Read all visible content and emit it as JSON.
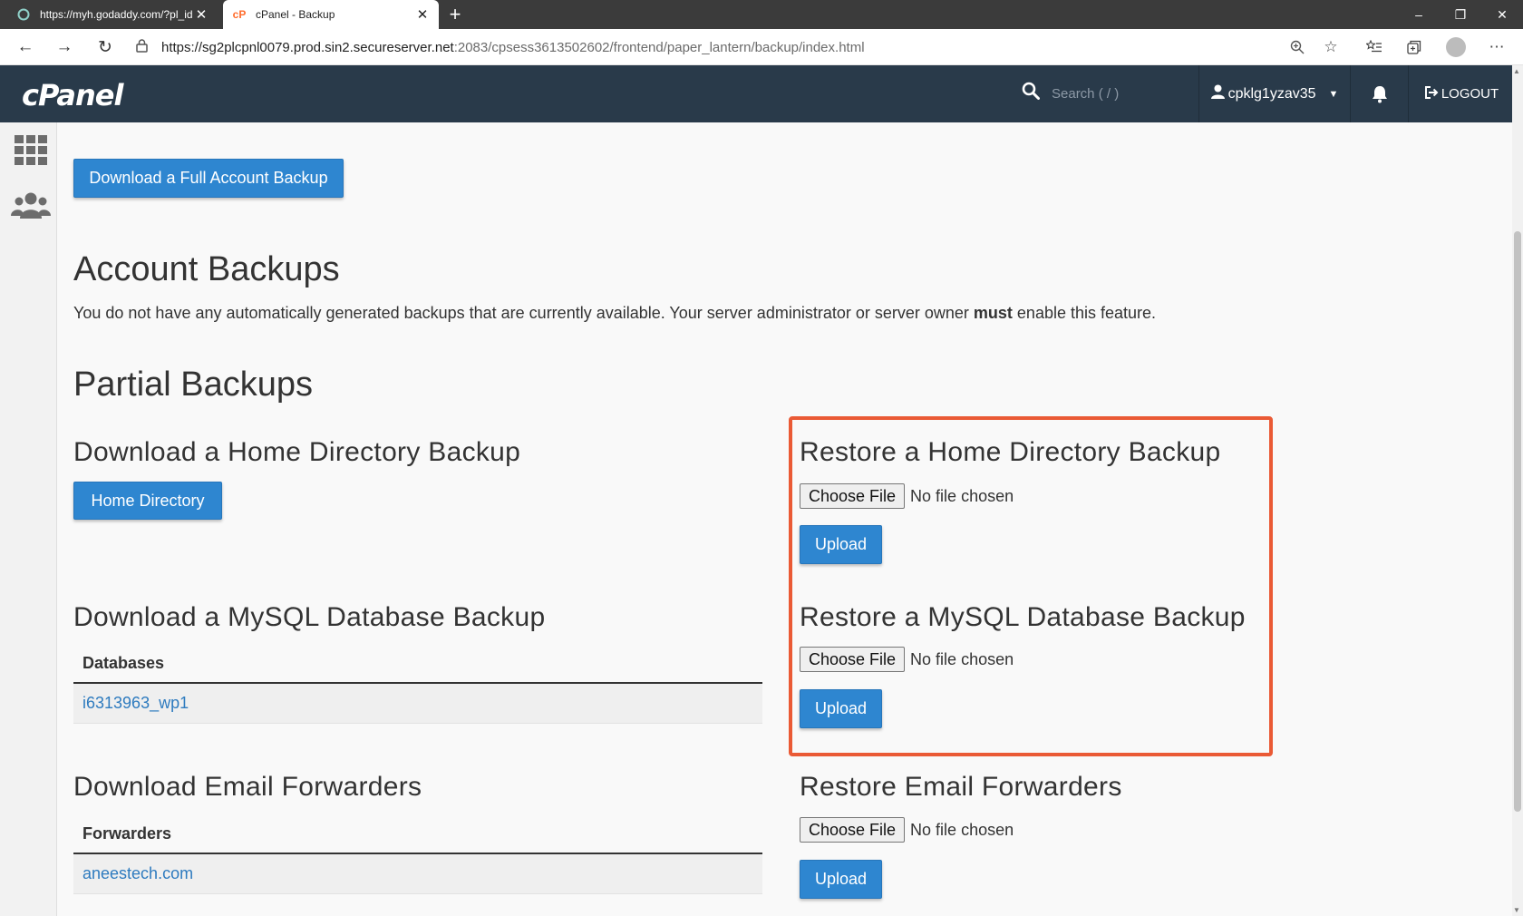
{
  "browser": {
    "tabs": [
      {
        "title": "https://myh.godaddy.com/?pl_id",
        "close": "✕"
      },
      {
        "title": "cPanel - Backup",
        "close": "✕"
      }
    ],
    "new_tab": "+",
    "window_controls": {
      "minimize": "–",
      "restore": "❐",
      "close": "✕"
    },
    "url_host": "https://sg2plcpnl0079.prod.sin2.secureserver.net",
    "url_path": ":2083/cpsess3613502602/frontend/paper_lantern/backup/index.html"
  },
  "header": {
    "logo": "cPanel",
    "search_placeholder": "Search ( / )",
    "username": "cpklg1yzav35",
    "logout": "LOGOUT"
  },
  "content": {
    "full_backup_button": "Download a Full Account Backup",
    "account_backups": {
      "title": "Account Backups",
      "text_before": "You do not have any automatically generated backups that are currently available. Your server administrator or server owner ",
      "text_bold": "must",
      "text_after": " enable this feature."
    },
    "partial_backups_title": "Partial Backups",
    "home_download": {
      "title": "Download a Home Directory Backup",
      "button": "Home Directory"
    },
    "home_restore": {
      "title": "Restore a Home Directory Backup",
      "choose": "Choose File",
      "status": "No file chosen",
      "upload": "Upload"
    },
    "mysql_download": {
      "title": "Download a MySQL Database Backup",
      "column": "Databases",
      "rows": [
        "i6313963_wp1"
      ]
    },
    "mysql_restore": {
      "title": "Restore a MySQL Database Backup",
      "choose": "Choose File",
      "status": "No file chosen",
      "upload": "Upload"
    },
    "email_download": {
      "title": "Download Email Forwarders",
      "column": "Forwarders",
      "rows": [
        "aneestech.com"
      ]
    },
    "email_restore": {
      "title": "Restore Email Forwarders",
      "choose": "Choose File",
      "status": "No file chosen",
      "upload": "Upload"
    }
  },
  "colors": {
    "header_bg": "#293a4a",
    "primary_button": "#2e86d0",
    "link": "#2e7bbf",
    "highlight_border": "#ea5a35"
  }
}
